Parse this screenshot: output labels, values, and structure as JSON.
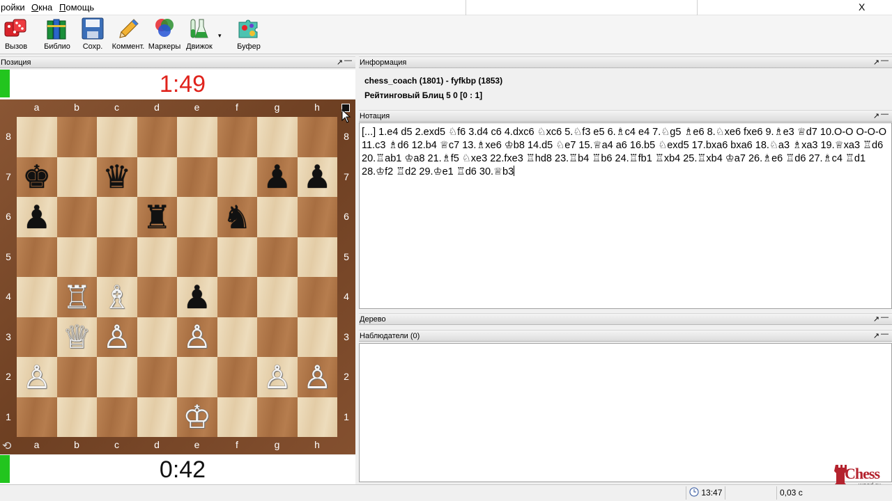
{
  "menu": {
    "items": [
      {
        "label": "ройки"
      },
      {
        "label": "Окна",
        "underline": "О",
        "rest": "кна"
      },
      {
        "label": "Помощь",
        "underline": "П",
        "rest": "омощь"
      }
    ],
    "close": "X"
  },
  "toolbar": {
    "buttons": [
      {
        "label": "Вызов",
        "icon": "dice-icon"
      },
      {
        "label": "Библио",
        "icon": "books-icon"
      },
      {
        "label": "Сохр.",
        "icon": "floppy-icon"
      },
      {
        "label": "Коммент.",
        "icon": "pencil-icon"
      },
      {
        "label": "Маркеры",
        "icon": "color-circles-icon"
      },
      {
        "label": "Движок",
        "icon": "flask-icon"
      },
      {
        "label": "Буфер",
        "icon": "puzzle-icon"
      }
    ],
    "dropdown_arrow": "▾"
  },
  "panels": {
    "position": "Позиция",
    "info": "Информация",
    "notation": "Нотация",
    "tree": "Дерево",
    "observers": "Наблюдатели (0)",
    "pin": "↗",
    "minimize": "—"
  },
  "clocks": {
    "top": {
      "time": "1:49",
      "color": "#e0231c"
    },
    "bottom": {
      "time": "0:42",
      "color": "#111111"
    }
  },
  "board": {
    "files": [
      "a",
      "b",
      "c",
      "d",
      "e",
      "f",
      "g",
      "h"
    ],
    "ranks": [
      "8",
      "7",
      "6",
      "5",
      "4",
      "3",
      "2",
      "1"
    ],
    "pieces": [
      {
        "square": "a7",
        "glyph": "♚",
        "color": "b"
      },
      {
        "square": "c7",
        "glyph": "♛",
        "color": "b"
      },
      {
        "square": "g7",
        "glyph": "♟",
        "color": "b"
      },
      {
        "square": "h7",
        "glyph": "♟",
        "color": "b"
      },
      {
        "square": "a6",
        "glyph": "♟",
        "color": "b"
      },
      {
        "square": "d6",
        "glyph": "♜",
        "color": "b"
      },
      {
        "square": "f6",
        "glyph": "♞",
        "color": "b"
      },
      {
        "square": "b4",
        "glyph": "♖",
        "color": "w"
      },
      {
        "square": "c4",
        "glyph": "♗",
        "color": "w"
      },
      {
        "square": "e4",
        "glyph": "♟",
        "color": "b"
      },
      {
        "square": "b3",
        "glyph": "♕",
        "color": "w"
      },
      {
        "square": "c3",
        "glyph": "♙",
        "color": "w"
      },
      {
        "square": "e3",
        "glyph": "♙",
        "color": "w"
      },
      {
        "square": "a2",
        "glyph": "♙",
        "color": "w"
      },
      {
        "square": "g2",
        "glyph": "♙",
        "color": "w"
      },
      {
        "square": "h2",
        "glyph": "♙",
        "color": "w"
      },
      {
        "square": "e1",
        "glyph": "♔",
        "color": "w"
      }
    ]
  },
  "info": {
    "players": "chess_coach (1801) - fyfkbp (1853)",
    "game_type": "Рейтинговый Блиц 5 0 [0 : 1]"
  },
  "notation": {
    "text": "[...] 1.e4 d5 2.exd5 ♘f6 3.d4 c6 4.dxc6 ♘xc6 5.♘f3 e5 6.♗c4 e4 7.♘g5 ♗e6 8.♘xe6 fxe6 9.♗e3 ♕d7 10.O-O O-O-O 11.c3 ♗d6 12.b4 ♕c7 13.♗xe6 ♔b8 14.d5 ♘e7 15.♕a4 a6 16.b5 ♘exd5 17.bxa6 bxa6 18.♘a3 ♗xa3 19.♕xa3 ♖d6 20.♖ab1 ♔a8 21.♗f5 ♘xe3 22.fxe3 ♖hd8 23.♖b4 ♖b6 24.♖fb1 ♖xb4 25.♖xb4 ♔a7 26.♗e6 ♖d6 27.♗c4 ♖d1 28.♔f2 ♖d2 29.♔e1 ♖d6 30.♕b3"
  },
  "status": {
    "time": "13:47",
    "engine_time": "0,03 с"
  },
  "logo": {
    "line1": "Chess",
    "line2": "wood.ru"
  }
}
